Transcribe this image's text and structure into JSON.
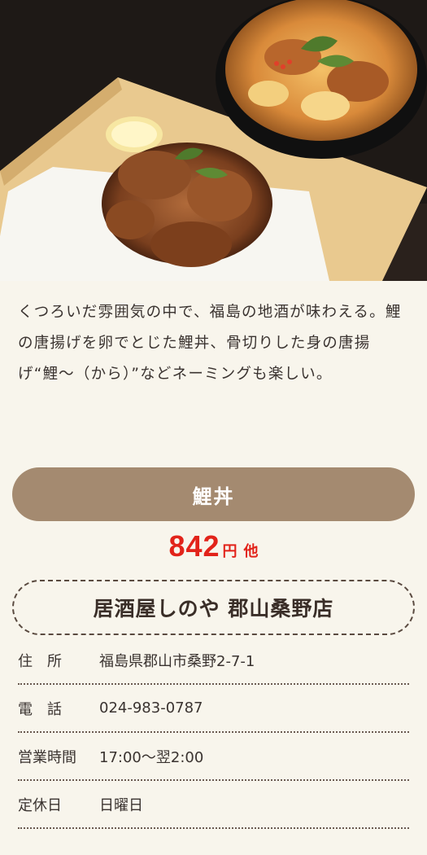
{
  "description": "くつろいだ雰囲気の中で、福島の地酒が味わえる。鯉の唐揚げを卵でとじた鯉丼、骨切りした身の唐揚げ“鯉～（から）”などネーミングも楽しい。",
  "dish": {
    "name": "鯉丼",
    "price": "842",
    "price_unit": "円",
    "price_suffix": "他"
  },
  "shop": {
    "name": "居酒屋しのや 郡山桑野店"
  },
  "info": [
    {
      "label": "住　所",
      "value": "福島県郡山市桑野2-7-1"
    },
    {
      "label": "電　話",
      "value": "024-983-0787"
    },
    {
      "label": "営業時間",
      "value": "17:00～翌2:00"
    },
    {
      "label": "定休日",
      "value": "日曜日"
    }
  ],
  "colors": {
    "background": "#f8f5ec",
    "button": "#a48a70",
    "price": "#e2231a"
  }
}
